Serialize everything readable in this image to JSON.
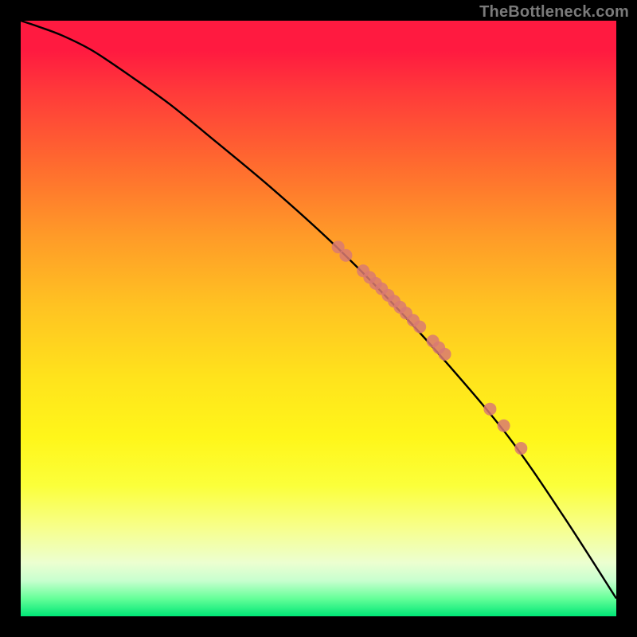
{
  "watermark": "TheBottleneck.com",
  "colors": {
    "background": "#000000",
    "curve": "#000000",
    "marker_fill": "#d97a72",
    "marker_stroke": "#c76a63"
  },
  "chart_data": {
    "type": "line",
    "title": "",
    "xlabel": "",
    "ylabel": "",
    "xlim": [
      0,
      100
    ],
    "ylim": [
      0,
      100
    ],
    "grid": false,
    "legend": false,
    "series": [
      {
        "name": "curve",
        "x": [
          0,
          3,
          7,
          12,
          18,
          25,
          33,
          42,
          52,
          62,
          72,
          82,
          91,
          100
        ],
        "y": [
          100,
          99,
          97.5,
          95,
          91,
          86,
          79.5,
          72,
          63,
          53,
          42,
          30,
          17,
          3
        ]
      }
    ],
    "markers": [
      {
        "x": 53.3,
        "y": 62.0
      },
      {
        "x": 54.6,
        "y": 60.6
      },
      {
        "x": 57.5,
        "y": 58.0
      },
      {
        "x": 58.6,
        "y": 56.9
      },
      {
        "x": 59.6,
        "y": 55.9
      },
      {
        "x": 60.6,
        "y": 55.0
      },
      {
        "x": 61.7,
        "y": 53.9
      },
      {
        "x": 62.7,
        "y": 52.9
      },
      {
        "x": 63.7,
        "y": 51.9
      },
      {
        "x": 64.7,
        "y": 50.9
      },
      {
        "x": 65.9,
        "y": 49.7
      },
      {
        "x": 67.0,
        "y": 48.6
      },
      {
        "x": 69.2,
        "y": 46.2
      },
      {
        "x": 70.2,
        "y": 45.1
      },
      {
        "x": 71.2,
        "y": 44.0
      },
      {
        "x": 78.8,
        "y": 34.8
      },
      {
        "x": 81.1,
        "y": 32.0
      },
      {
        "x": 84.0,
        "y": 28.2
      }
    ],
    "marker_radius": 8
  }
}
